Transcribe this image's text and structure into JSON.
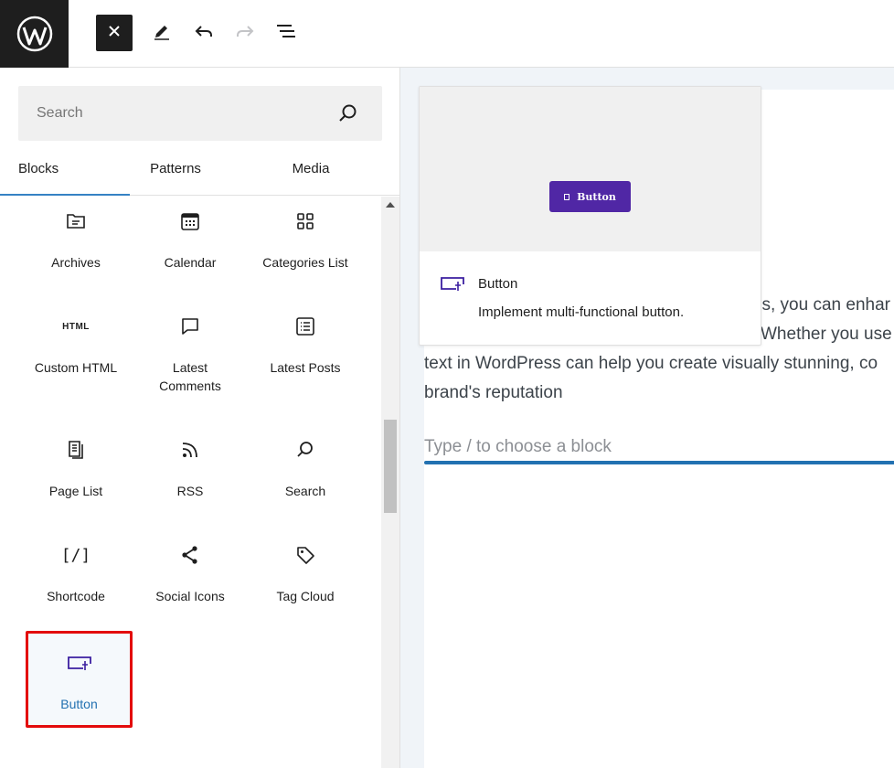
{
  "toolbar": {
    "logo_icon": "wordpress-logo-icon",
    "close_icon": "close-icon",
    "tools_icon": "pencil-icon",
    "undo_icon": "undo-icon",
    "redo_icon": "redo-icon",
    "outline_icon": "list-view-icon"
  },
  "inserter": {
    "search": {
      "placeholder": "Search",
      "icon": "search-icon"
    },
    "tabs": [
      {
        "label": "Blocks",
        "active": true
      },
      {
        "label": "Patterns",
        "active": false
      },
      {
        "label": "Media",
        "active": false
      }
    ],
    "blocks": [
      {
        "label": "Archives",
        "icon": "archive-icon"
      },
      {
        "label": "Calendar",
        "icon": "calendar-icon"
      },
      {
        "label": "Categories List",
        "icon": "categories-icon"
      },
      {
        "label": "Custom HTML",
        "icon": "html-icon",
        "icon_text": "HTML"
      },
      {
        "label": "Latest\nComments",
        "icon": "comment-icon"
      },
      {
        "label": "Latest Posts",
        "icon": "latest-posts-icon"
      },
      {
        "label": "Page List",
        "icon": "page-list-icon"
      },
      {
        "label": "RSS",
        "icon": "rss-icon"
      },
      {
        "label": "Search",
        "icon": "search-icon"
      },
      {
        "label": "Shortcode",
        "icon": "shortcode-icon",
        "icon_text": "[/]"
      },
      {
        "label": "Social Icons",
        "icon": "share-icon"
      },
      {
        "label": "Tag Cloud",
        "icon": "tag-icon"
      },
      {
        "label": "Button",
        "icon": "button-icon",
        "selected": true
      }
    ]
  },
  "preview": {
    "button_text": "Button",
    "title": "Button",
    "description": "Implement multi-functional button.",
    "button_color": "#5027a5"
  },
  "editor": {
    "lines": [
      "ss, you can enhar",
      "Whether you use",
      "text in WordPress can help you create visually stunning, co",
      "brand's reputation"
    ],
    "placeholder": "Type / to choose a block",
    "accent_color": "#2271b1"
  }
}
